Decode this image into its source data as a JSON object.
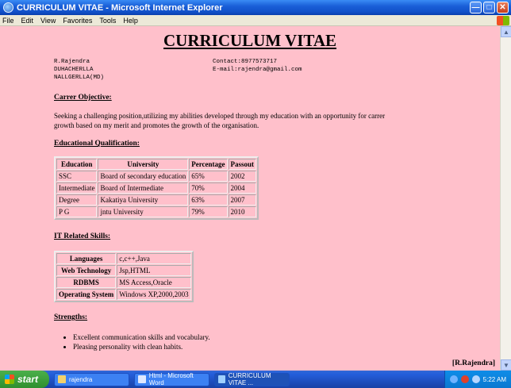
{
  "window": {
    "title": "CURRICULUM VITAE - Microsoft Internet Explorer"
  },
  "menu": [
    "File",
    "Edit",
    "View",
    "Favorites",
    "Tools",
    "Help"
  ],
  "resume": {
    "title": "CURRICULUM VITAE",
    "name": "R.Rajendra",
    "address_line1": "DUHACHERLLA",
    "address_line2": "NALLGERLLA(MD)",
    "contact": "Contact:8977573717",
    "email": "E-mail:rajendra@gmail.com",
    "objective_heading": "Carrer Objective:",
    "objective_text": "Seeking a challenging position,utilizing my abilities developed through my education with an opportunity for carrer growth based on my merit and promotes the growth of the organisation.",
    "education_heading": "Educational Qualification:",
    "education_columns": [
      "Education",
      "University",
      "Percentage",
      "Passout"
    ],
    "education_rows": [
      [
        "SSC",
        "Board of secondary education",
        "65%",
        "2002"
      ],
      [
        "Intermediate",
        "Board of Intermediate",
        "70%",
        "2004"
      ],
      [
        "Degree",
        "Kakatiya University",
        "63%",
        "2007"
      ],
      [
        "P G",
        "jntu University",
        "79%",
        "2010"
      ]
    ],
    "skills_heading": "IT Related Skills:",
    "skills_rows": [
      [
        "Languages",
        "c,c++,Java"
      ],
      [
        "Web Technology",
        "Jsp,HTML"
      ],
      [
        "RDBMS",
        "MS Access,Oracle"
      ],
      [
        "Operating System",
        "Windows XP,2000,2003"
      ]
    ],
    "strengths_heading": "Strengths:",
    "strengths": [
      "Excellent communication skills and vocabulary.",
      "Pleasing personality with clean habits."
    ],
    "signature": "[R.Rajendra]"
  },
  "taskbar": {
    "start_label": "start",
    "tasks": [
      "rajendra",
      "Html - Microsoft Word",
      "CURRICULUM VITAE ..."
    ],
    "clock": "5:22 AM"
  },
  "colors": {
    "page_background": "#ffc0cb",
    "titlebar": "#1a5fd8"
  },
  "icons": [
    "ie-icon",
    "minimize-icon",
    "maximize-icon",
    "close-icon",
    "windows-flag-icon",
    "folder-icon",
    "word-icon",
    "ie-task-icon"
  ]
}
